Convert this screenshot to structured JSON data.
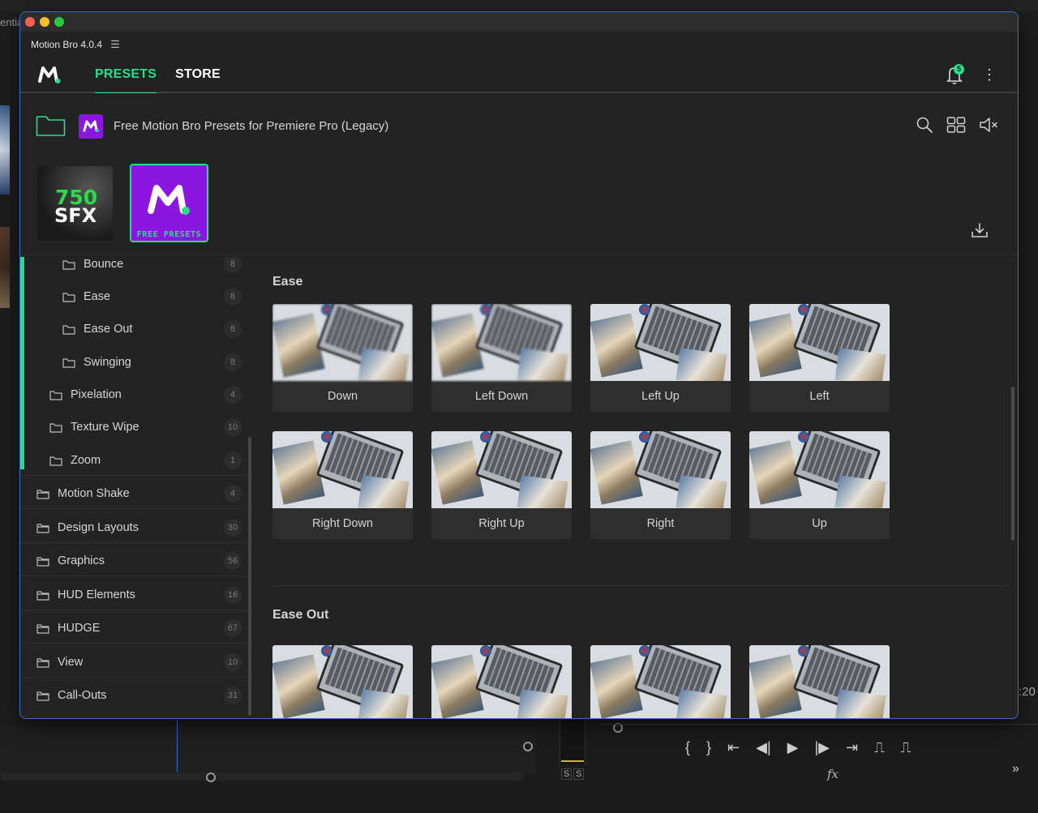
{
  "host": {
    "left_text": "entia",
    "timecode": ":20",
    "solo_1": "S",
    "solo_2": "S",
    "fx_label": "fx",
    "forward_glyph": "»",
    "controls": [
      "{",
      "}",
      "⇤",
      "◀|",
      "▶",
      "|▶",
      "⇥",
      "⎍",
      "⎍"
    ]
  },
  "window": {
    "app_title": "Motion Bro 4.0.4",
    "menu_glyph": "☰",
    "tabs": [
      {
        "label": "PRESETS",
        "active": true
      },
      {
        "label": "STORE",
        "active": false
      }
    ],
    "notifications_count": "5",
    "kebab_glyph": "⋮",
    "accent_color": "#2bdc8a"
  },
  "pathbar": {
    "title": "Free Motion Bro Presets for Premiere Pro (Legacy)",
    "pack_thumb_label": "M"
  },
  "packs": [
    {
      "name": "750 SFX",
      "line1": "750",
      "line2": "SFX",
      "selected": false
    },
    {
      "name": "Free Presets",
      "badge_text": "FREE PRESETS",
      "selected": true
    }
  ],
  "sidebar": {
    "items": [
      {
        "label": "Bounce",
        "count": "8",
        "level": 2
      },
      {
        "label": "Ease",
        "count": "8",
        "level": 2
      },
      {
        "label": "Ease Out",
        "count": "8",
        "level": 2
      },
      {
        "label": "Swinging",
        "count": "8",
        "level": 2
      },
      {
        "label": "Pixelation",
        "count": "4",
        "level": 1
      },
      {
        "label": "Texture Wipe",
        "count": "10",
        "level": 1
      },
      {
        "label": "Zoom",
        "count": "1",
        "level": 1
      },
      {
        "label": "Motion Shake",
        "count": "4",
        "level": 0
      },
      {
        "label": "Design Layouts",
        "count": "30",
        "level": 0
      },
      {
        "label": "Graphics",
        "count": "56",
        "level": 0
      },
      {
        "label": "HUD Elements",
        "count": "16",
        "level": 0
      },
      {
        "label": "HUDGE",
        "count": "67",
        "level": 0
      },
      {
        "label": "View",
        "count": "10",
        "level": 0
      },
      {
        "label": "Call-Outs",
        "count": "31",
        "level": 0
      }
    ]
  },
  "content": {
    "sections": [
      {
        "title": "Ease",
        "presets": [
          "Down",
          "Left Down",
          "Left Up",
          "Left",
          "Right Down",
          "Right Up",
          "Right",
          "Up"
        ]
      },
      {
        "title": "Ease Out",
        "presets": [
          "",
          "",
          "",
          ""
        ]
      }
    ]
  }
}
